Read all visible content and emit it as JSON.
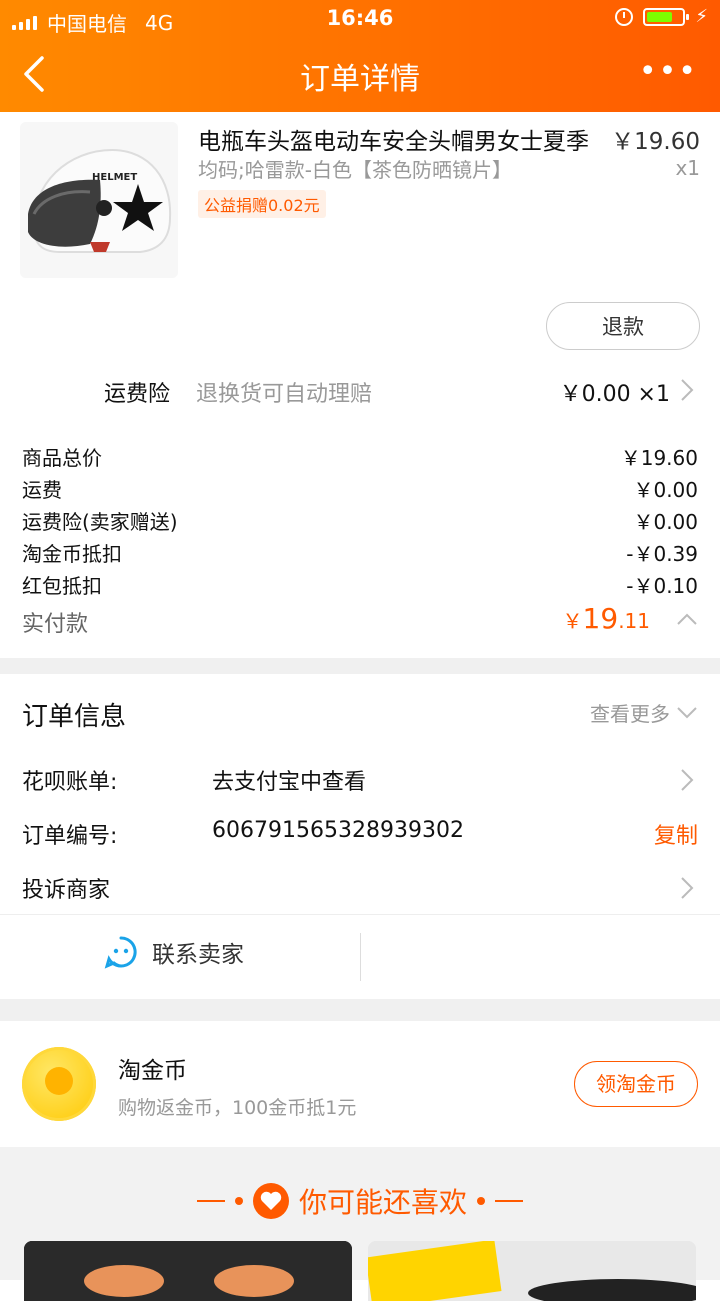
{
  "status": {
    "carrier": "中国电信",
    "network": "4G",
    "time": "16:46"
  },
  "nav": {
    "title": "订单详情",
    "more": "•••"
  },
  "product": {
    "name": "电瓶车头盔电动车安全头帽男女士夏季",
    "sku": "均码;哈雷款-白色【茶色防晒镜片】",
    "badge": "公益捐赠0.02元",
    "price": "￥19.60",
    "qty": "x1",
    "helmet_text": "HELMET",
    "refund": "退款"
  },
  "insurance": {
    "label": "运费险",
    "desc": "退换货可自动理赔",
    "value": "￥0.00 ×1"
  },
  "totals": [
    {
      "k": "商品总价",
      "v": "￥19.60"
    },
    {
      "k": "运费",
      "v": "￥0.00"
    },
    {
      "k": "运费险(卖家赠送)",
      "v": "￥0.00"
    },
    {
      "k": "淘金币抵扣",
      "v": "-￥0.39"
    },
    {
      "k": "红包抵扣",
      "v": "-￥0.10"
    }
  ],
  "paid": {
    "label": "实付款",
    "cur": "￥",
    "int": "19",
    "dec": ".11"
  },
  "order_info": {
    "title": "订单信息",
    "more": "查看更多",
    "huabei_k": "花呗账单:",
    "huabei_v": "去支付宝中查看",
    "order_no_k": "订单编号:",
    "order_no_v": "606791565328939302",
    "copy": "复制",
    "complain": "投诉商家"
  },
  "contact": {
    "label": "联系卖家"
  },
  "coins": {
    "title": "淘金币",
    "desc": "购物返金币，100金币抵1元",
    "button": "领淘金币"
  },
  "reco": {
    "title": "你可能还喜欢"
  }
}
